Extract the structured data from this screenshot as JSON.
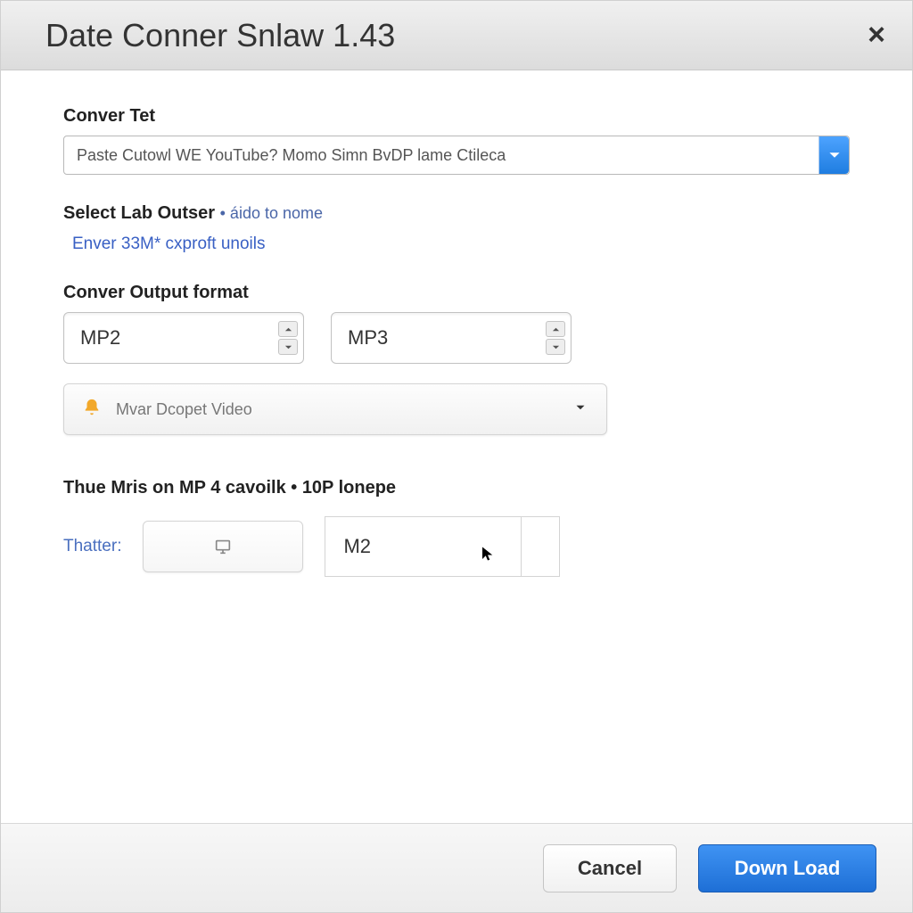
{
  "window": {
    "title": "Date Conner Snlaw 1.43"
  },
  "url_section": {
    "label": "Conver Tet",
    "input_value": "Paste Cutowl WE YouTube? Momo Simn BvDP lame Ctileca"
  },
  "select_section": {
    "label": "Select Lab Outser",
    "suffix": "• áido to nome",
    "link": "Enver 33M* cxproft unoils"
  },
  "format_section": {
    "label": "Conver Output format",
    "spinner1": "MP2",
    "spinner2": "MP3",
    "expander_label": "Mvar Dcopet Video"
  },
  "hint_section": {
    "text": "Thue Mris on MP 4 cavoilk • 10P lonepe",
    "thatter_label": "Thatter:",
    "m2_value": "M2"
  },
  "footer": {
    "cancel": "Cancel",
    "download": "Down Load"
  }
}
